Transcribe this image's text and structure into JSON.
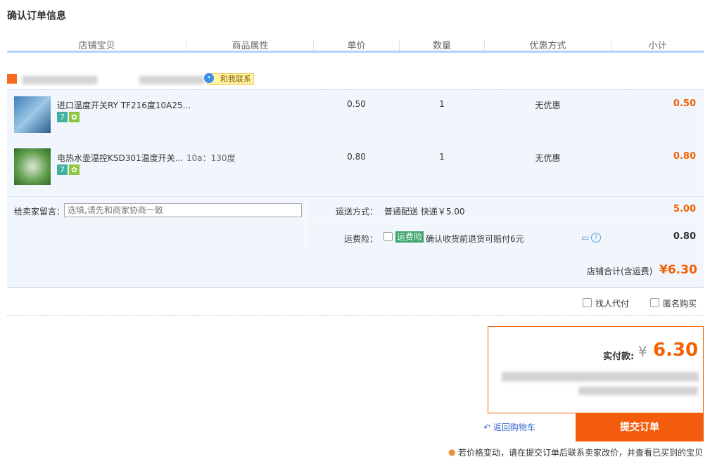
{
  "page_title": "确认订单信息",
  "columns": [
    "店铺宝贝",
    "商品属性",
    "单价",
    "数量",
    "优惠方式",
    "小计"
  ],
  "shop": {
    "contact_label": "和我联系"
  },
  "items": [
    {
      "name": "进口温度开关RY TF216度10A25...",
      "attr": "",
      "price": "0.50",
      "qty": "1",
      "discount": "无优惠",
      "subtotal": "0.50"
    },
    {
      "name": "电热水壶温控KSD301温度开关...",
      "attr": "10a：130度",
      "price": "0.80",
      "qty": "1",
      "discount": "无优惠",
      "subtotal": "0.80"
    }
  ],
  "badges": {
    "seven_days": "7",
    "guarantee": "✿"
  },
  "memo": {
    "label": "给卖家留言：",
    "placeholder": "选填,请先和商家协商一致"
  },
  "shipping": {
    "label": "运送方式：",
    "method": "普通配送  快递￥5.00",
    "cost": "5.00"
  },
  "insurance": {
    "label": "运费险：",
    "tag": "运费险",
    "desc": "确认收货前退货可赔付6元",
    "cost": "0.80"
  },
  "shop_total": {
    "label": "店铺合计(含运费)",
    "value": "¥6.30"
  },
  "options": {
    "proxy_pay": "找人代付",
    "anonymous": "匿名购买"
  },
  "pay": {
    "label": "实付款:",
    "currency": "¥",
    "amount": "6.30"
  },
  "actions": {
    "back_label": "返回购物车",
    "submit_label": "提交订单"
  },
  "notice": "若价格变动，请在提交订单后联系卖家改价，并查看已买到的宝贝",
  "colors": {
    "accent": "#f36100",
    "header_line": "#b2d1ff",
    "row_bg": "#f1f6fd"
  }
}
